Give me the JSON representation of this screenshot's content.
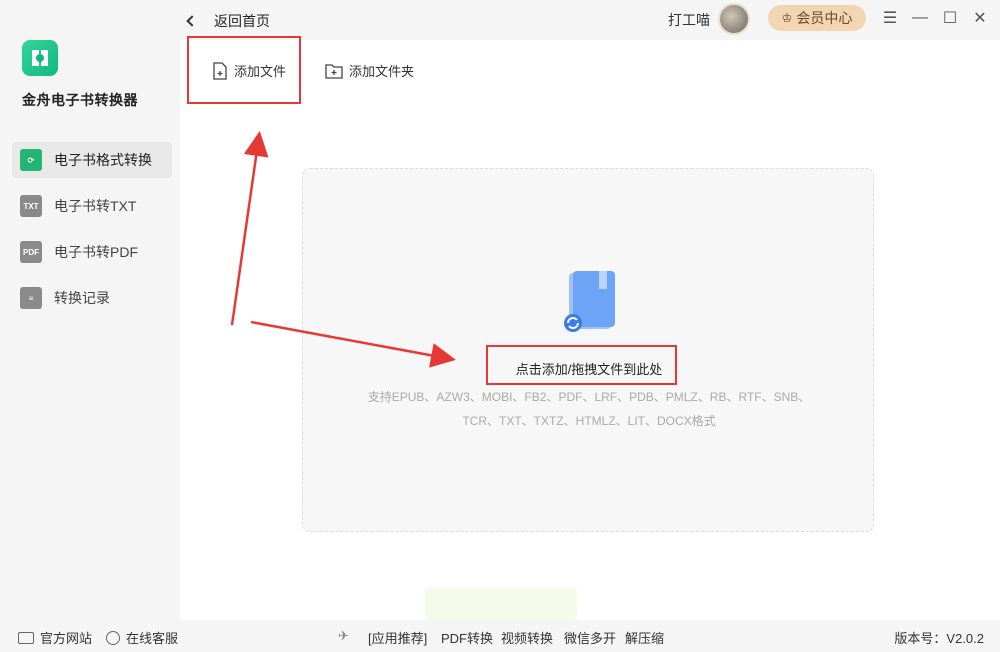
{
  "app": {
    "name": "金舟电子书转换器"
  },
  "sidebar": {
    "items": [
      {
        "label": "电子书格式转换",
        "icon": "refresh-icon",
        "active": true
      },
      {
        "label": "电子书转TXT",
        "icon_text": "TXT"
      },
      {
        "label": "电子书转PDF",
        "icon_text": "PDF"
      },
      {
        "label": "转换记录",
        "icon": "list-icon"
      }
    ]
  },
  "topbar": {
    "back_label": "返回首页",
    "username": "打工喵",
    "vip_label": "会员中心"
  },
  "toolbar": {
    "add_file_label": "添加文件",
    "add_folder_label": "添加文件夹"
  },
  "dropzone": {
    "prompt": "点击添加/拖拽文件到此处",
    "formats_line1": "支持EPUB、AZW3、MOBI、FB2、PDF、LRF、PDB、PMLZ、RB、RTF、SNB、",
    "formats_line2": "TCR、TXT、TXTZ、HTMLZ、LIT、DOCX格式"
  },
  "footer": {
    "website": "官方网站",
    "support": "在线客服",
    "apps_recommend": "[应用推荐]",
    "pdf_convert": "PDF转换",
    "video_convert": "视频转换",
    "wechat_multi": "微信多开",
    "unzip": "解压缩",
    "version": "版本号：V2.0.2"
  },
  "colors": {
    "accent": "#22b573",
    "annotation_red": "#e53935",
    "vip_bg": "#f2d6b3"
  }
}
